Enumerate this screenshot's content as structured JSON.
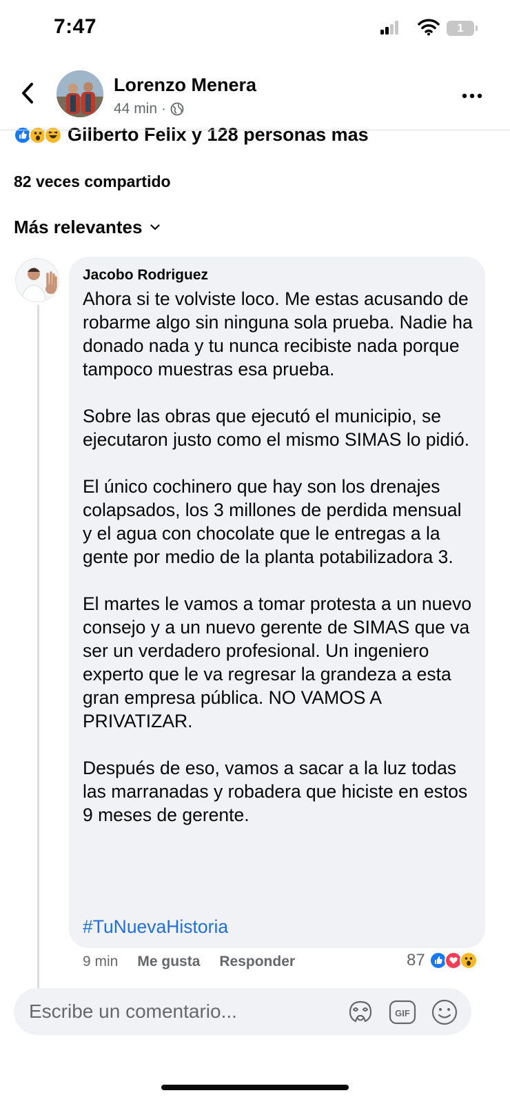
{
  "status_bar": {
    "time": "7:47",
    "battery_level": "1"
  },
  "header": {
    "poster_name": "Lorenzo Menera",
    "post_time": "44 min",
    "separator": "·",
    "privacy_icon": "globe-icon"
  },
  "post_stats": {
    "reactions_text": "Gilberto Felix y 128 personas mas",
    "reaction_icons": [
      "like-icon",
      "wow-icon",
      "haha-icon"
    ],
    "shares_text": "82 veces compartido"
  },
  "sort": {
    "label": "Más relevantes"
  },
  "comment": {
    "author": "Jacobo Rodriguez",
    "paragraphs": [
      "Ahora si te volviste loco. Me estas acusando de robarme algo sin ninguna sola prueba. Nadie ha donado nada y tu nunca recibiste nada porque tampoco muestras esa prueba.",
      "Sobre las obras que ejecutó el municipio, se ejecutaron justo como el mismo SIMAS lo pidió.",
      "El único cochinero que hay son los drenajes colapsados, los 3 millones de perdida mensual y el agua con chocolate que le entregas a la gente por medio de la planta potabilizadora 3.",
      "El martes le vamos a tomar protesta a un nuevo consejo y a un nuevo gerente de SIMAS que va ser un verdadero profesional. Un ingeniero experto que le va regresar la grandeza a esta gran empresa pública. NO VAMOS A PRIVATIZAR.",
      "Después de eso, vamos a sacar a la luz todas las marranadas y robadera que hiciste en estos 9 meses de gerente."
    ],
    "hashtag": "#TuNuevaHistoria",
    "time": "9 min",
    "like_label": "Me gusta",
    "reply_label": "Responder",
    "reaction_count": "87",
    "reaction_icons": [
      "like-icon",
      "love-icon",
      "wow-icon"
    ]
  },
  "composer": {
    "placeholder": "Escribe un comentario...",
    "gif_label": "GIF"
  },
  "colors": {
    "text": "#050505",
    "secondary_text": "#65676b",
    "bubble": "#f0f2f5",
    "link": "#216fdb",
    "like_blue": "#1877f2",
    "love_red": "#f33e58",
    "wow_yellow": "#f7b928"
  }
}
